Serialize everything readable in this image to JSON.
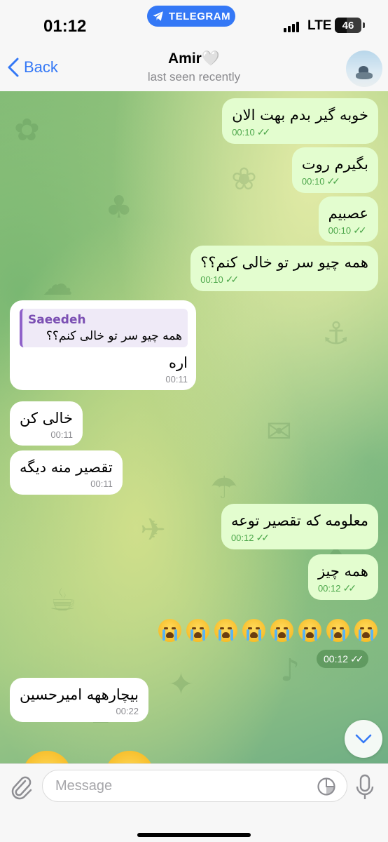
{
  "status_bar": {
    "time": "01:12",
    "app_pill": "TELEGRAM",
    "network": "LTE",
    "battery": "46",
    "battery_level_percent": 46
  },
  "header": {
    "back_label": "Back",
    "title": "Amir🤍",
    "subtitle": "last seen recently"
  },
  "messages": [
    {
      "text": "خوبه گیر بدم بهت الان",
      "time": "00:10"
    },
    {
      "text": "بگیرم روت",
      "time": "00:10"
    },
    {
      "text": "عصبیم",
      "time": "00:10"
    },
    {
      "text": "همه چیو سر تو خالی کنم؟؟",
      "time": "00:10"
    },
    {
      "reply_name": "Saeedeh",
      "reply_text": "همه چیو سر تو خالی کنم؟؟",
      "text": "اره",
      "time": "00:11"
    },
    {
      "text": "خالی کن",
      "time": "00:11"
    },
    {
      "text": "تقصیر منه دیگه",
      "time": "00:11"
    },
    {
      "text": "معلومه که تقصیر توعه",
      "time": "00:12"
    },
    {
      "text": "همه چیز",
      "time": "00:12"
    },
    {
      "emoji": "😭😭😭😭😭😭😭😭",
      "time": "00:12"
    },
    {
      "text": "بیچارههه امیرحسین",
      "time": "00:22"
    }
  ],
  "input": {
    "placeholder": "Message"
  },
  "colors": {
    "accent": "#3478f6",
    "outgoing_bubble": "#e3fdcf",
    "incoming_bubble": "#ffffff",
    "check_green": "#4ca64a",
    "reply_purple": "#7b4fb3"
  }
}
